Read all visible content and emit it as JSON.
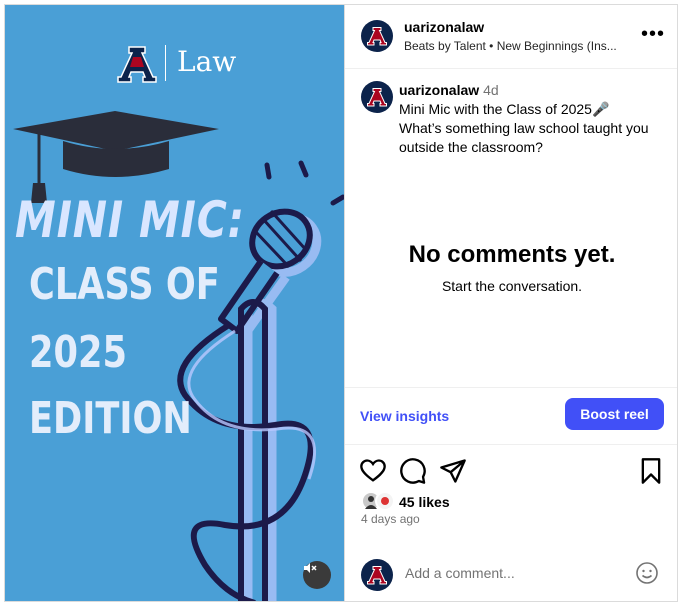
{
  "media": {
    "brand_text": "Law",
    "headline": "MINI MIC:",
    "lines": [
      "CLASS OF",
      "2025",
      "EDITION"
    ],
    "background_color": "#4a9fd6",
    "mute_icon": "speaker-muted-icon"
  },
  "header": {
    "username": "uarizonalaw",
    "audio": "Beats by Talent • New Beginnings (Ins...",
    "more_icon": "more-options-icon"
  },
  "caption": {
    "username": "uarizonalaw",
    "time": "4d",
    "line1": "Mini Mic with the Class of 2025🎤",
    "line2": "What’s something law school taught you outside the classroom?"
  },
  "comments": {
    "empty_title": "No comments yet.",
    "empty_sub": "Start the conversation."
  },
  "insights": {
    "link": "View insights",
    "boost": "Boost reel",
    "accent": "#4150f7"
  },
  "actions": {
    "icons": [
      "heart-icon",
      "comment-icon",
      "share-icon",
      "bookmark-icon"
    ],
    "likes": "45 likes",
    "posted": "4 days ago"
  },
  "add_comment": {
    "placeholder": "Add a comment...",
    "emoji_icon": "emoji-icon"
  }
}
